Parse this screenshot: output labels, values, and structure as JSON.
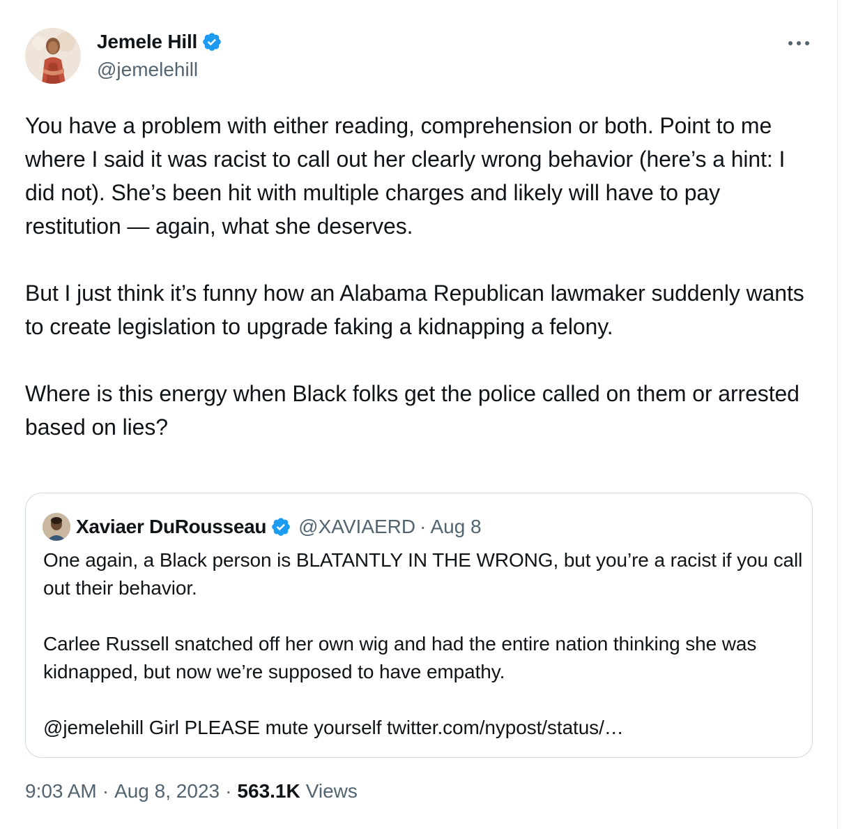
{
  "author": {
    "display_name": "Jemele Hill",
    "handle": "@jemelehill",
    "verified_icon": "verified-badge-icon",
    "more_icon": "more-options-icon"
  },
  "tweet": {
    "paragraphs": [
      "You have a problem with either reading, comprehension or both. Point to me where I said it was racist to call out her clearly wrong behavior (here’s a hint: I did not). She’s been hit with multiple charges and likely will have to pay restitution — again, what she deserves.",
      "But I just think it’s funny how an Alabama Republican lawmaker suddenly wants to create legislation to upgrade faking a kidnapping a felony.",
      "Where is this energy when Black folks get the police called on them or arrested based on lies?"
    ]
  },
  "quoted": {
    "display_name": "Xaviaer DuRousseau",
    "handle": "@XAVIAERD",
    "separator": "·",
    "date": "Aug 8",
    "paragraphs": [
      "One again, a Black person is BLATANTLY IN THE WRONG, but you’re a racist if you call out their behavior.",
      "Carlee Russell snatched off her own wig and had the entire nation thinking she was kidnapped, but now we’re supposed to have empathy.",
      "@jemelehill Girl PLEASE mute yourself twitter.com/nypost/status/…"
    ]
  },
  "meta": {
    "time": "9:03 AM",
    "separator": "·",
    "date": "Aug 8, 2023",
    "views_count": "563.1K",
    "views_label": "Views"
  },
  "colors": {
    "verified_blue": "#1d9bf0",
    "text_primary": "#0f1419",
    "text_secondary": "#536471",
    "border": "#cfd9de"
  }
}
